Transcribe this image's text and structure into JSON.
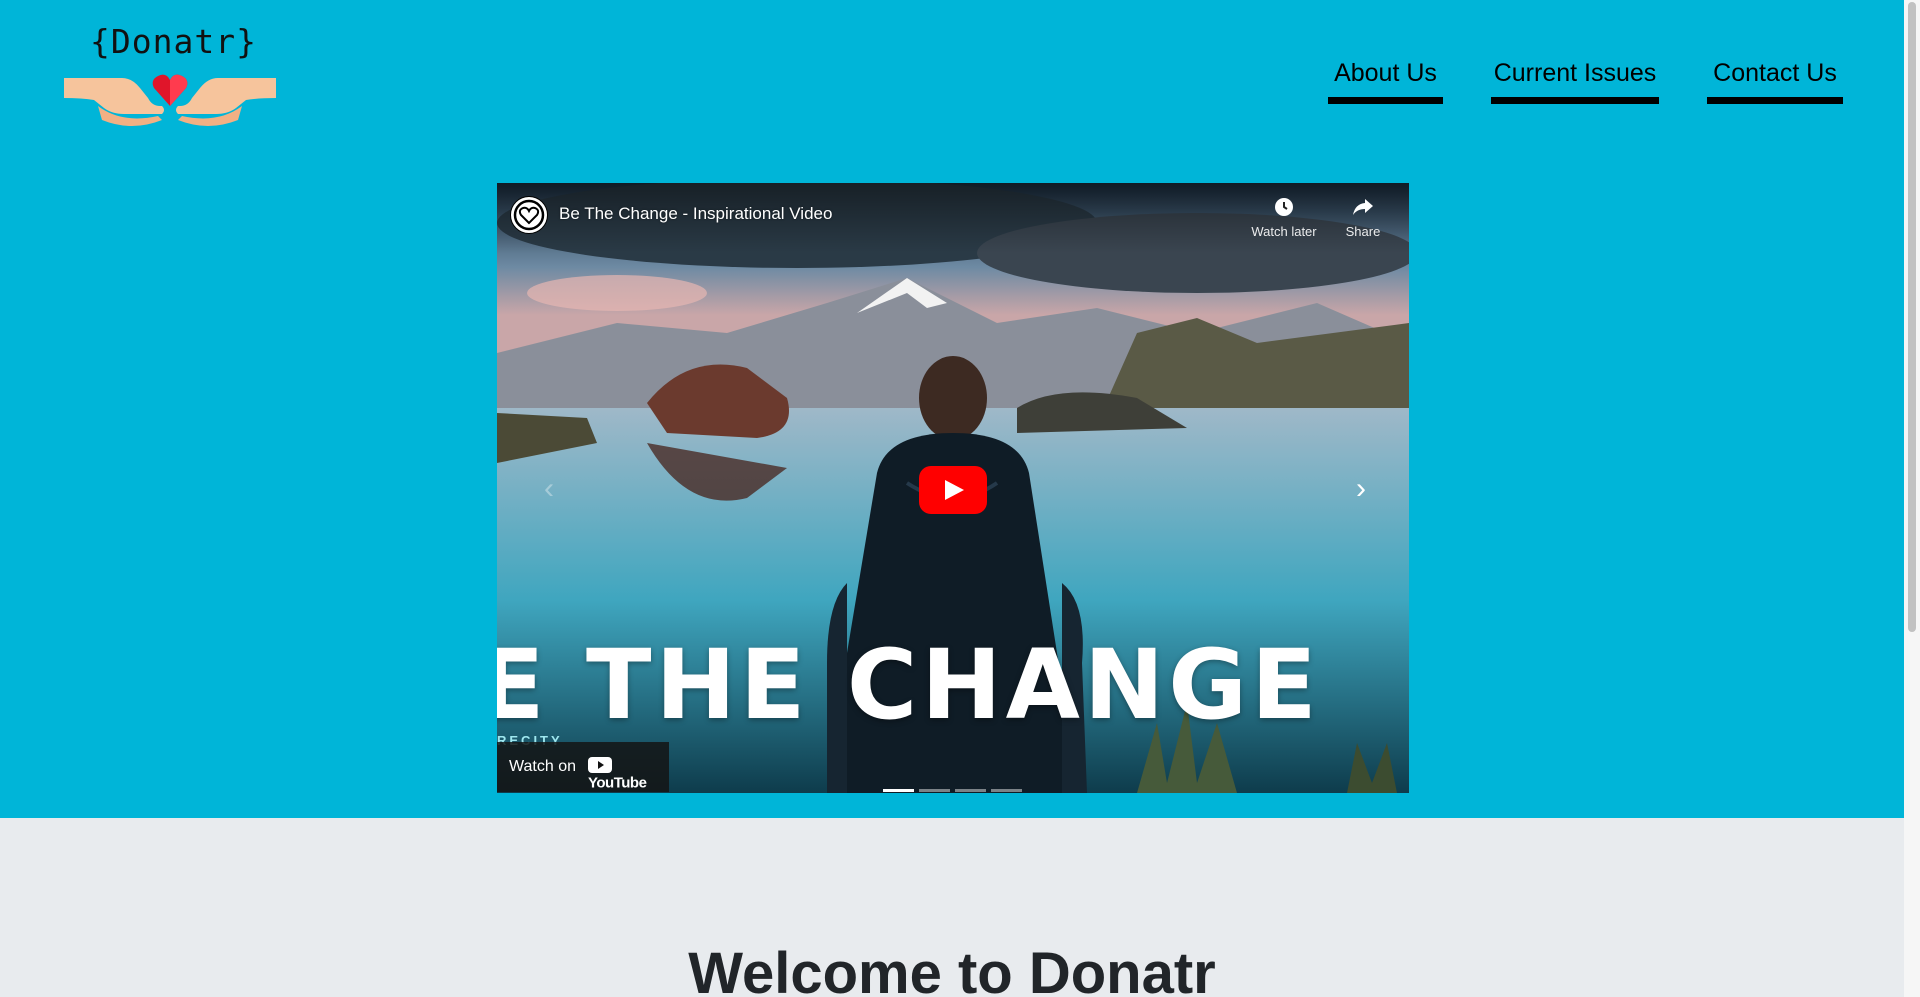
{
  "brand": {
    "logo_text": "{Donatr}"
  },
  "nav": {
    "items": [
      {
        "label": "About Us"
      },
      {
        "label": "Current Issues"
      },
      {
        "label": "Contact Us"
      }
    ]
  },
  "video": {
    "title": "Be The Change - Inspirational Video",
    "watch_later": "Watch later",
    "share": "Share",
    "overlay_text": "E THE CHANGE",
    "sub_credit": "RECITY",
    "watch_on": "Watch on",
    "youtube": "YouTube",
    "carousel_slides": 4,
    "active_slide": 1
  },
  "welcome": {
    "heading": "Welcome to Donatr"
  },
  "colors": {
    "hero_bg": "#00b5d8",
    "page_bg": "#e8ebee",
    "play_red": "#ff0000"
  }
}
